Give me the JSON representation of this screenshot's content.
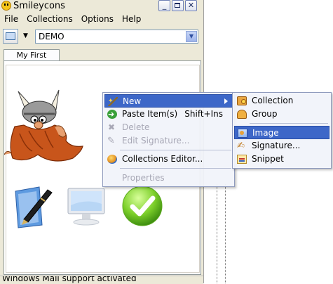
{
  "window": {
    "title": "Smileycons",
    "controls": {
      "minimize": "_",
      "maximize": "□",
      "close": "✕"
    }
  },
  "menubar": [
    {
      "label": "File"
    },
    {
      "label": "Collections"
    },
    {
      "label": "Options"
    },
    {
      "label": "Help"
    }
  ],
  "toolbar": {
    "collection_select": "DEMO"
  },
  "tabs": [
    {
      "label": "My First Group"
    }
  ],
  "status": "Windows Mail support activated",
  "context_menu": [
    {
      "label": "New",
      "state": "highlighted",
      "submenu": true,
      "icon": "magic-wand-icon"
    },
    {
      "label": "Paste Item(s)",
      "shortcut": "Shift+Ins",
      "icon": "paste-icon"
    },
    {
      "label": "Delete",
      "state": "disabled",
      "icon": "delete-icon"
    },
    {
      "label": "Edit Signature...",
      "state": "disabled",
      "icon": "edit-signature-icon"
    },
    {
      "label": "Collections Editor...",
      "icon": "collections-editor-icon"
    },
    {
      "label": "Properties",
      "state": "disabled"
    }
  ],
  "new_submenu": [
    {
      "label": "Collection",
      "icon": "collection-icon"
    },
    {
      "label": "Group",
      "icon": "group-icon"
    },
    {
      "label": "Image",
      "state": "highlighted",
      "icon": "image-icon"
    },
    {
      "label": "Signature...",
      "icon": "signature-icon"
    },
    {
      "label": "Snippet",
      "icon": "snippet-icon"
    }
  ],
  "colors": {
    "highlight": "#3d67c8",
    "menu_bg": "#f1f3fa",
    "window_bg": "#ece9d8"
  }
}
